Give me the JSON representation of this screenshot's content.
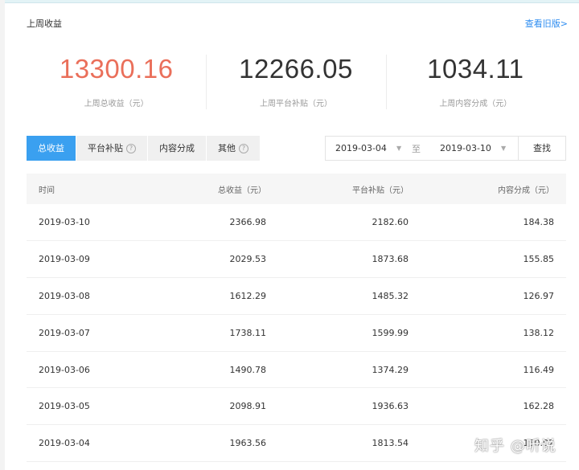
{
  "header": {
    "title": "上周收益",
    "old_version_link": "查看旧版>"
  },
  "stats": [
    {
      "value": "13300.16",
      "label": "上周总收益（元）"
    },
    {
      "value": "12266.05",
      "label": "上周平台补贴（元）"
    },
    {
      "value": "1034.11",
      "label": "上周内容分成（元）"
    }
  ],
  "tabs": [
    {
      "label": "总收益",
      "active": true
    },
    {
      "label": "平台补贴",
      "help": "?"
    },
    {
      "label": "内容分成"
    },
    {
      "label": "其他",
      "help": "?"
    }
  ],
  "date_range": {
    "start": "2019-03-04",
    "separator": "至",
    "end": "2019-03-10",
    "search_label": "查找"
  },
  "table": {
    "headers": [
      "时间",
      "总收益（元）",
      "平台补贴（元）",
      "内容分成（元）"
    ],
    "rows": [
      [
        "2019-03-10",
        "2366.98",
        "2182.60",
        "184.38"
      ],
      [
        "2019-03-09",
        "2029.53",
        "1873.68",
        "155.85"
      ],
      [
        "2019-03-08",
        "1612.29",
        "1485.32",
        "126.97"
      ],
      [
        "2019-03-07",
        "1738.11",
        "1599.99",
        "138.12"
      ],
      [
        "2019-03-06",
        "1490.78",
        "1374.29",
        "116.49"
      ],
      [
        "2019-03-05",
        "2098.91",
        "1936.63",
        "162.28"
      ],
      [
        "2019-03-04",
        "1963.56",
        "1813.54",
        "150.02"
      ]
    ]
  },
  "watermark": "知乎 @听说",
  "colors": {
    "accent": "#3aa0f0",
    "total_value": "#ea6f5a",
    "link": "#2d8cf0"
  }
}
